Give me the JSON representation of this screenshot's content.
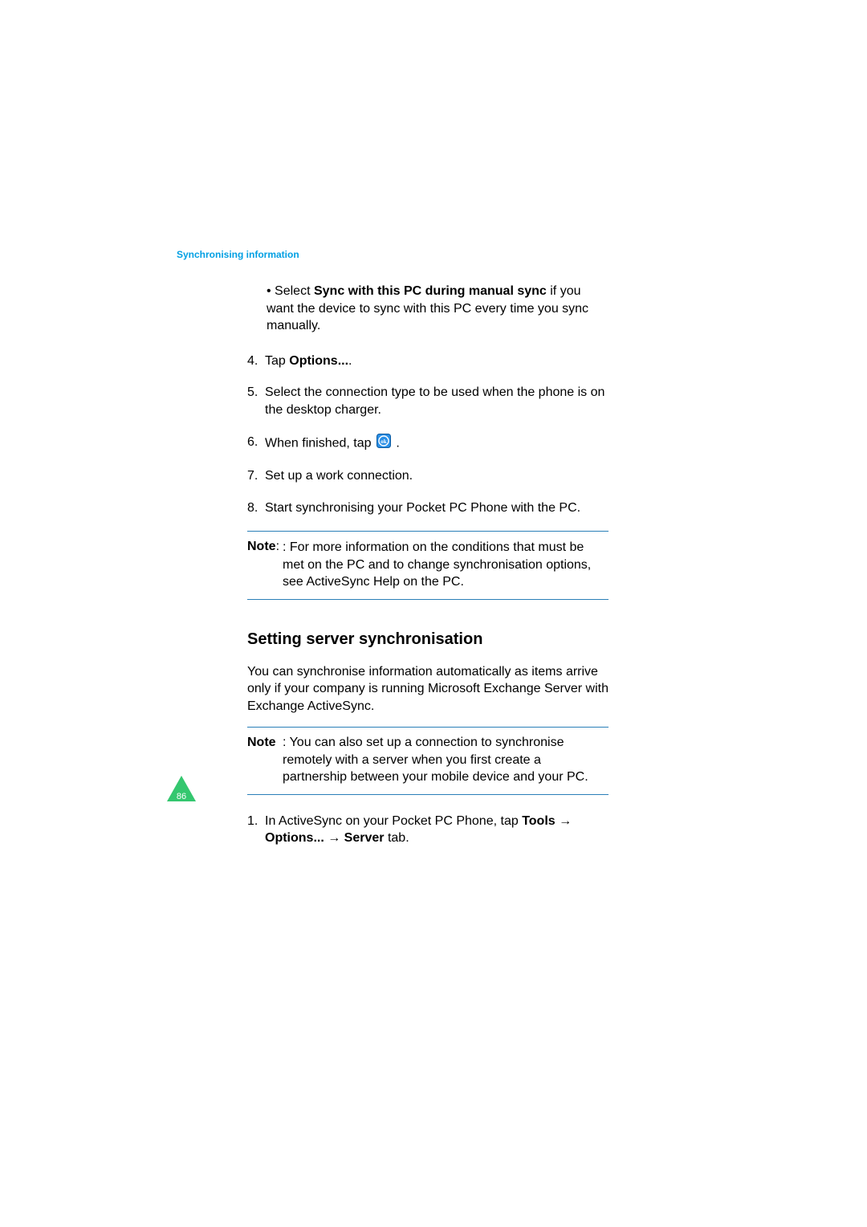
{
  "header": {
    "title": "Synchronising information"
  },
  "bullet1": {
    "prefix": "• Select ",
    "bold": "Sync with this PC during manual sync",
    "suffix": " if you want the device to sync with this PC every time you sync manually."
  },
  "step4": {
    "marker": "4.",
    "t1": "Tap ",
    "bold": "Options...",
    "t2": "."
  },
  "step5": {
    "marker": "5.",
    "text": "Select the connection type to be used when the phone is on the desktop charger."
  },
  "step6": {
    "marker": "6.",
    "t1": "When finished, tap ",
    "t2": "."
  },
  "step7": {
    "marker": "7.",
    "text": "Set up a work connection."
  },
  "step8": {
    "marker": "8.",
    "text": "Start synchronising your Pocket PC Phone with the PC."
  },
  "note1": {
    "label": "Note",
    "text": ": For more information on the conditions that must be met on the PC and to change synchronisation options, see ActiveSync Help on the PC."
  },
  "section": {
    "heading": "Setting server synchronisation",
    "para": "You can synchronise information automatically as items arrive only if your company is running Microsoft Exchange Server with Exchange ActiveSync."
  },
  "note2": {
    "label": "Note",
    "text": ": You can also set up a connection to synchronise remotely with a server when you first create a partnership between your mobile device and your PC."
  },
  "step1b": {
    "marker": "1.",
    "t1": "In ActiveSync on your Pocket PC Phone, tap ",
    "b1": "Tools",
    "arrow1": " → ",
    "b2": "Options...",
    "arrow2": " → ",
    "b3": " Server",
    "t2": " tab."
  },
  "pageNumber": "86",
  "okIcon": "ok"
}
